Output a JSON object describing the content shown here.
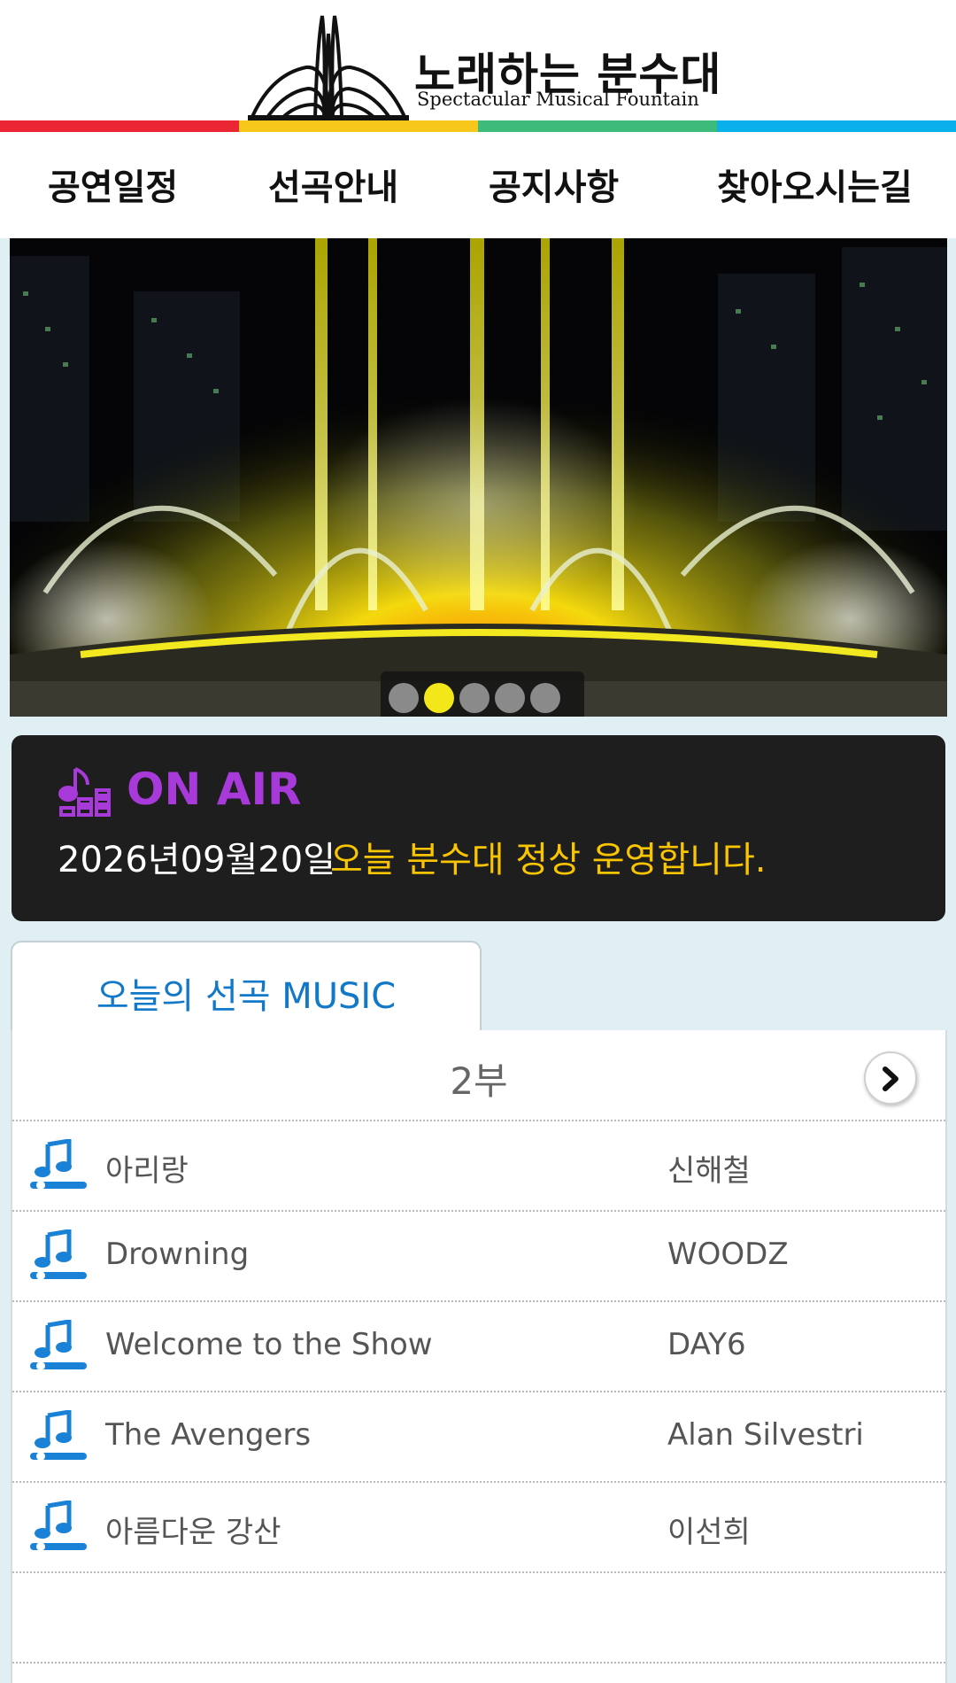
{
  "header": {
    "logo_korean": "노래하는 분수대",
    "logo_english": "Spectacular Musical Fountain",
    "color_bar": [
      "#ea2634",
      "#f7c81b",
      "#3dbb7a",
      "#0ab0ea"
    ]
  },
  "nav": {
    "items": [
      {
        "label": "공연일정"
      },
      {
        "label": "선곡안내"
      },
      {
        "label": "공지사항"
      },
      {
        "label": "찾아오시는길"
      }
    ]
  },
  "banner": {
    "slide_count": 5,
    "active_slide": 2,
    "dot_active_color": "#f3e71a"
  },
  "onair": {
    "title": "ON AIR",
    "icon": "music-equalizer-icon",
    "date": "2026년09월20일",
    "message": "오늘 분수대 정상 운영합니다.",
    "title_color": "#a73ad8",
    "message_color": "#f9c400"
  },
  "music": {
    "tab_label": "오늘의 선곡 MUSIC",
    "part_label": "2부",
    "next_icon": "chevron-right-icon",
    "song_icon": "music-note-icon",
    "songs": [
      {
        "title": "아리랑",
        "artist": "신해철"
      },
      {
        "title": "Drowning",
        "artist": "WOODZ"
      },
      {
        "title": "Welcome to the Show",
        "artist": "DAY6"
      },
      {
        "title": "The Avengers",
        "artist": "Alan Silvestri"
      },
      {
        "title": "아름다운 강산",
        "artist": "이선희"
      }
    ]
  }
}
